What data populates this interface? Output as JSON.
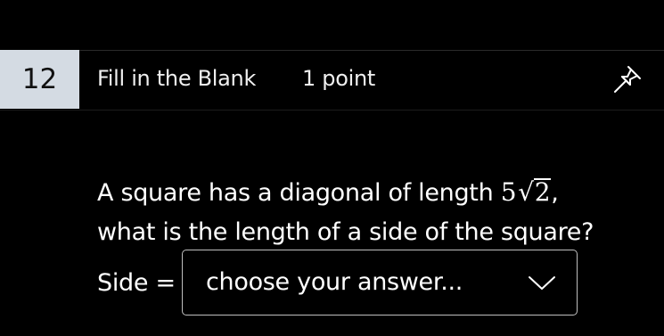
{
  "question": {
    "number": "12",
    "type": "Fill in the Blank",
    "points": "1 point",
    "prompt_before": "A square has a diagonal of length ",
    "math_coefficient": "5",
    "math_radical": "√",
    "math_radicand": "2",
    "prompt_comma": ",",
    "prompt_after": "what is the length of a side of the square?",
    "answer_label": "Side =",
    "select_placeholder": "choose your answer..."
  },
  "icons": {
    "pin": "pin-icon",
    "dropdown": "chevron-down-icon"
  },
  "colors": {
    "background": "#000000",
    "number_badge": "#d4dbe3",
    "text": "#ffffff",
    "select_border": "#bfbfbf"
  }
}
